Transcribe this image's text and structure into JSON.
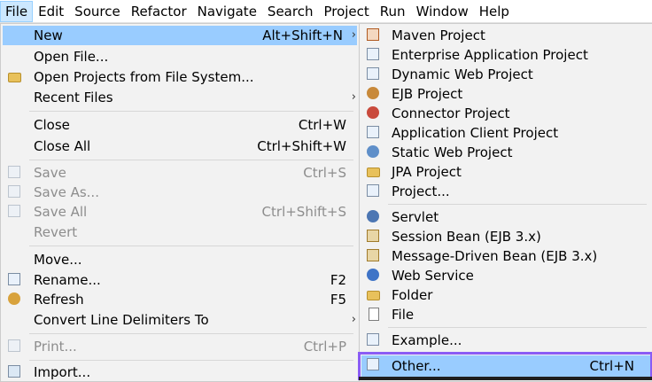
{
  "menubar": {
    "items": [
      "File",
      "Edit",
      "Source",
      "Refactor",
      "Navigate",
      "Search",
      "Project",
      "Run",
      "Window",
      "Help"
    ]
  },
  "file_menu": {
    "new": {
      "label": "New",
      "accel": "Alt+Shift+N",
      "arrow": "›"
    },
    "open_file": {
      "label": "Open File..."
    },
    "open_projects": {
      "label": "Open Projects from File System..."
    },
    "recent_files": {
      "label": "Recent Files",
      "arrow": "›"
    },
    "close": {
      "label": "Close",
      "accel": "Ctrl+W"
    },
    "close_all": {
      "label": "Close All",
      "accel": "Ctrl+Shift+W"
    },
    "save": {
      "label": "Save",
      "accel": "Ctrl+S"
    },
    "save_as": {
      "label": "Save As..."
    },
    "save_all": {
      "label": "Save All",
      "accel": "Ctrl+Shift+S"
    },
    "revert": {
      "label": "Revert"
    },
    "move": {
      "label": "Move..."
    },
    "rename": {
      "label": "Rename...",
      "accel": "F2"
    },
    "refresh": {
      "label": "Refresh",
      "accel": "F5"
    },
    "convert": {
      "label": "Convert Line Delimiters To",
      "arrow": "›"
    },
    "print": {
      "label": "Print...",
      "accel": "Ctrl+P"
    },
    "import": {
      "label": "Import..."
    }
  },
  "new_submenu": {
    "maven_project": "Maven Project",
    "enterprise_app": "Enterprise Application Project",
    "dynamic_web": "Dynamic Web Project",
    "ejb_project": "EJB Project",
    "connector_project": "Connector Project",
    "app_client": "Application Client Project",
    "static_web": "Static Web Project",
    "jpa_project": "JPA Project",
    "project": "Project...",
    "servlet": "Servlet",
    "session_bean": "Session Bean (EJB 3.x)",
    "mdb": "Message-Driven Bean (EJB 3.x)",
    "web_service": "Web Service",
    "folder": "Folder",
    "file": "File",
    "example": "Example...",
    "other": {
      "label": "Other...",
      "accel": "Ctrl+N"
    }
  },
  "colors": {
    "highlight": "#99ccff",
    "menu_bg": "#f2f2f2",
    "focus_frame": "#8a5cf5"
  }
}
